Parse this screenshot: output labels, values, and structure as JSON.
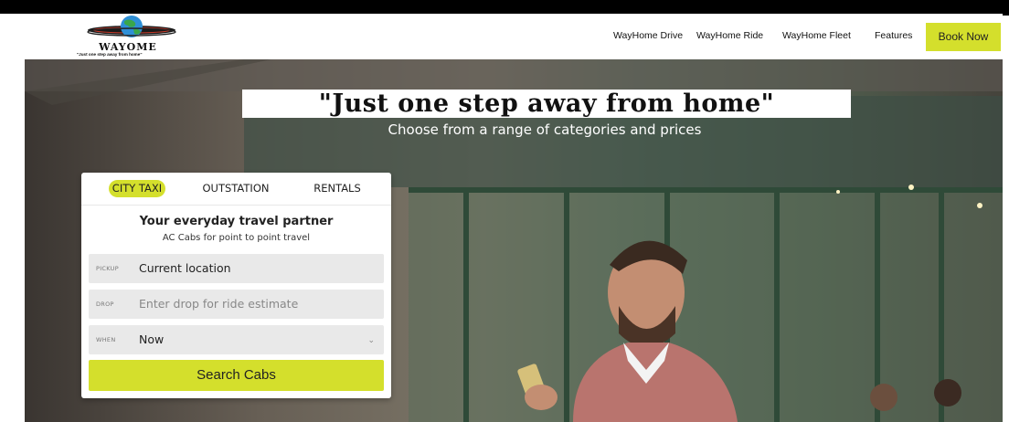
{
  "brand": {
    "logo_word": "WAYOME",
    "logo_tagline": "\"Just one step away from home\""
  },
  "nav": {
    "items": [
      {
        "label": "WayHome Drive"
      },
      {
        "label": "WayHome Ride"
      },
      {
        "label": "WayHome Fleet"
      },
      {
        "label": "Features"
      }
    ],
    "cta_label": "Book Now"
  },
  "hero": {
    "headline": "\"Just one step away from home\"",
    "subheadline": "Choose from a range of categories and prices"
  },
  "booking": {
    "tabs": [
      {
        "label": "CITY TAXI",
        "active": true
      },
      {
        "label": "OUTSTATION",
        "active": false
      },
      {
        "label": "RENTALS",
        "active": false
      }
    ],
    "title": "Your everyday travel partner",
    "subtitle": "AC Cabs for point to point travel",
    "pickup": {
      "label": "PICKUP",
      "value": "Current location"
    },
    "drop": {
      "label": "DROP",
      "placeholder": "Enter drop for ride estimate"
    },
    "when": {
      "label": "WHEN",
      "value": "Now"
    },
    "search_label": "Search Cabs"
  },
  "colors": {
    "accent": "#d4df2c",
    "topbar": "#000000"
  }
}
